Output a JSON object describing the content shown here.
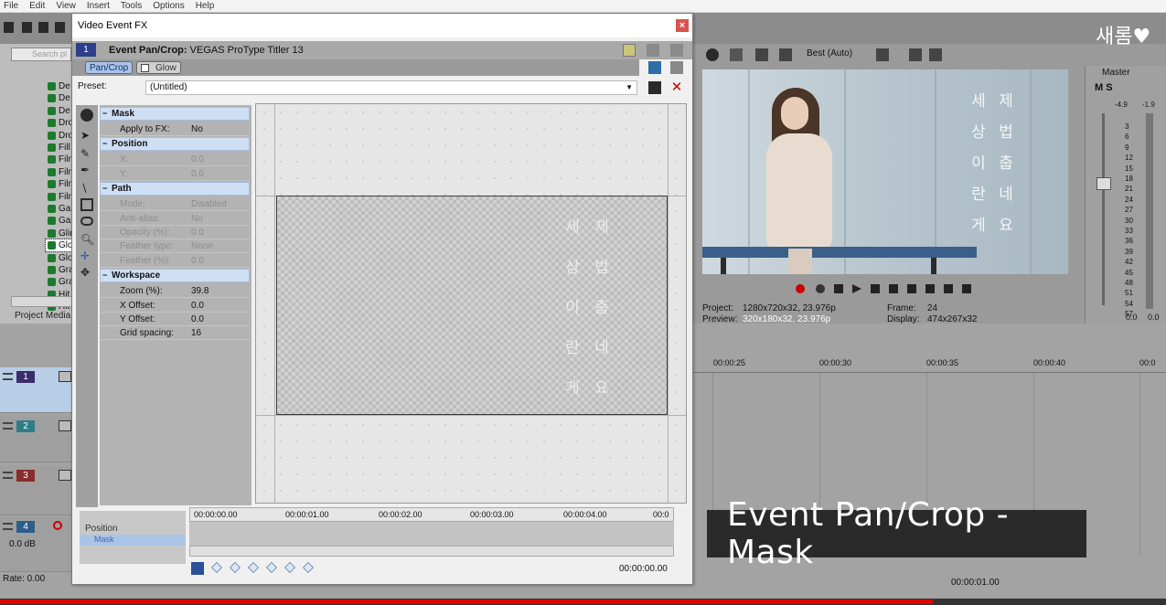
{
  "app": {
    "menu": [
      "File",
      "Edit",
      "View",
      "Insert",
      "Tools",
      "Options",
      "Help"
    ]
  },
  "explorer": {
    "search_placeholder": "Search pl",
    "items": [
      "De",
      "De",
      "De",
      "Dro",
      "Dro",
      "Fill",
      "Film",
      "Film",
      "Film",
      "Film",
      "Ga",
      "Ga",
      "Glin",
      "Glo",
      "Glo",
      "Gra",
      "Gra",
      "Hit",
      "Hit"
    ],
    "selected_index": 13,
    "tab_label": "Project Media"
  },
  "dialog": {
    "title": "Video Event FX",
    "close_label": "×",
    "fx_badge": "1",
    "fx_header_bold": "Event Pan/Crop:",
    "fx_header_rest": "VEGAS ProType Titler 13",
    "chain": [
      "Pan/Crop",
      "Glow"
    ],
    "preset_label": "Preset:",
    "preset_value": "(Untitled)",
    "sections": {
      "mask": {
        "title": "Mask",
        "rows": [
          {
            "label": "Apply to FX:",
            "value": "No"
          }
        ]
      },
      "position": {
        "title": "Position",
        "rows": [
          {
            "label": "X:",
            "value": "0.0"
          },
          {
            "label": "Y:",
            "value": "0.0"
          }
        ]
      },
      "path": {
        "title": "Path",
        "rows": [
          {
            "label": "Mode:",
            "value": "Disabled"
          },
          {
            "label": "Anti-alias:",
            "value": "No"
          },
          {
            "label": "Opacity (%):",
            "value": "0.0"
          },
          {
            "label": "Feather type:",
            "value": "None"
          },
          {
            "label": "Feather (%):",
            "value": "0.0"
          }
        ]
      },
      "workspace": {
        "title": "Workspace",
        "rows": [
          {
            "label": "Zoom (%):",
            "value": "39.8"
          },
          {
            "label": "X Offset:",
            "value": "0.0"
          },
          {
            "label": "Y Offset:",
            "value": "0.0"
          },
          {
            "label": "Grid spacing:",
            "value": "16"
          }
        ]
      }
    },
    "canvas_text": {
      "col1": [
        "세",
        "상",
        "이",
        "란",
        "게"
      ],
      "col2": [
        "제",
        "법",
        "춥",
        "네",
        "요"
      ]
    },
    "keyframes": {
      "row_position": "Position",
      "row_mask": "Mask",
      "ticks": [
        "00:00:00.00",
        "00:00:01.00",
        "00:00:02.00",
        "00:00:03.00",
        "00:00:04.00",
        "00:0"
      ],
      "current_time": "00:00:00.00"
    }
  },
  "preview": {
    "quality": "Best (Auto)",
    "project_label": "Project:",
    "project_value": "1280x720x32, 23.976p",
    "preview_label": "Preview:",
    "preview_value": "320x180x32, 23.976p",
    "frame_label": "Frame:",
    "frame_value": "24",
    "display_label": "Display:",
    "display_value": "474x267x32",
    "overlay_col1": [
      "세",
      "상",
      "이",
      "란",
      "게"
    ],
    "overlay_col2": [
      "제",
      "법",
      "춥",
      "네",
      "요"
    ]
  },
  "master": {
    "label": "Master",
    "ms": "M S",
    "peak_left": "-4.9",
    "peak_right": "-1.9",
    "scale": [
      "3",
      "6",
      "9",
      "12",
      "15",
      "18",
      "21",
      "24",
      "27",
      "30",
      "33",
      "36",
      "39",
      "42",
      "45",
      "48",
      "51",
      "54",
      "57"
    ],
    "left_value": "0.0",
    "right_value": "0.0"
  },
  "timeline": {
    "ticks": [
      "00:00:25",
      "00:00:30",
      "00:00:35",
      "00:00:40",
      "00:0"
    ],
    "tracks": [
      "1",
      "2",
      "3",
      "4"
    ],
    "audio_db": "0.0 dB",
    "rate": "Rate: 0.00",
    "cursor_time": "00:00:01.00"
  },
  "overlay": {
    "watermark": "새롬♥",
    "caption": "Event Pan/Crop - Mask",
    "video_progress": 0.8
  },
  "colors": {
    "accent_blue": "#2d3f8a",
    "section_header": "#cfdff3",
    "progress_red": "#e00000"
  }
}
